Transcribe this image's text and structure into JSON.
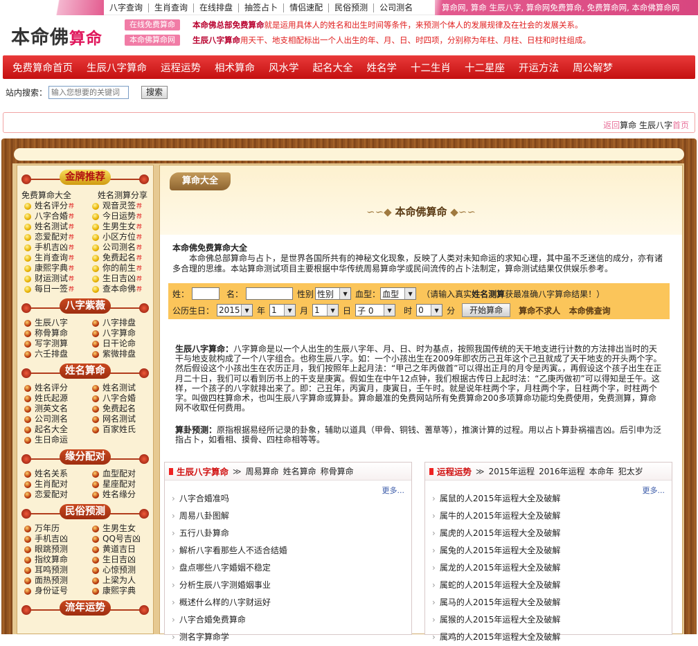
{
  "top_nav": [
    "八字查询",
    "生肖查询",
    "在线排盘",
    "抽签占卜",
    "情侣速配",
    "民俗预测",
    "公司测名"
  ],
  "top_right": "算命网, 算命  生辰八字, 算命网免费算命, 免费算命网, 本命佛算命网",
  "logo": {
    "main": "本命佛",
    "red": "算命"
  },
  "tags": [
    "在线免费算命",
    "本命佛算命网"
  ],
  "intro": [
    {
      "bold": "本命佛总部免费算命",
      "text": "就是运用具体人的姓名和出生时间等条件，来预测个体人的发展规律及在社会的发展关系。"
    },
    {
      "bold": "生辰八字算命",
      "text": "用天干、地支相配标出一个人出生的年、月、日、时四项，分别称为年柱、月柱、日柱和时柱组成。"
    }
  ],
  "main_nav": [
    "免费算命首页",
    "生辰八字算命",
    "运程运势",
    "相术算命",
    "风水学",
    "起名大全",
    "姓名学",
    "十二生肖",
    "十二星座",
    "开运方法",
    "周公解梦"
  ],
  "search": {
    "label": "站内搜索：",
    "placeholder": "输入您想要的关键词",
    "button": "搜索"
  },
  "breadcrumb": {
    "back": "返回",
    "path": "算命 生辰八字",
    "home": "首页"
  },
  "sidebar": {
    "sections": [
      {
        "title": "金牌推荐",
        "style": "gold",
        "subhdr": [
          "免费算命大全",
          "姓名测算分享"
        ],
        "icon": "bulb",
        "hot": true,
        "items": [
          "姓名评分",
          "观音灵签",
          "八字合婚",
          "今日运势",
          "姓名测试",
          "生男生女",
          "恋爱配对",
          "小区方位",
          "手机吉凶",
          "公司测名",
          "生肖查询",
          "免费起名",
          "康熙字典",
          "你的前生",
          "财运测试",
          "生日吉凶",
          "每日一签",
          "查本命佛"
        ]
      },
      {
        "title": "八字紫薇",
        "icon": "coin",
        "items": [
          "生辰八字",
          "八字排盘",
          "称骨算命",
          "八字算命",
          "写字测算",
          "日干论命",
          "六壬排盘",
          "紫微排盘"
        ]
      },
      {
        "title": "姓名算命",
        "icon": "coin",
        "items": [
          "姓名评分",
          "姓名测试",
          "姓氏起源",
          "八字合婚",
          "测英文名",
          "免费起名",
          "公司测名",
          "网名测试",
          "起名大全",
          "百家姓氏",
          "生日命运"
        ]
      },
      {
        "title": "缘分配对",
        "icon": "coin",
        "items": [
          "姓名关系",
          "血型配对",
          "生肖配对",
          "星座配对",
          "恋爱配对",
          "姓名缘分"
        ]
      },
      {
        "title": "民俗预测",
        "icon": "coin",
        "items": [
          "万年历",
          "生男生女",
          "手机吉凶",
          "QQ号吉凶",
          "眼跳预测",
          "黄道吉日",
          "指纹算命",
          "生日吉凶",
          "耳鸣预测",
          "心惊预测",
          "面热预测",
          "上梁为人",
          "身份证号",
          "康熙字典"
        ]
      },
      {
        "title": "流年运势",
        "icon": "coin",
        "items": []
      }
    ]
  },
  "content": {
    "tab": "算命大全",
    "title": "本命佛算命",
    "desc_title": "本命佛免费算命大全",
    "desc_text": "本命佛总部算命与占卜，是世界各国所共有的神秘文化现象，反映了人类对未知命运的求知心理，其中虽不乏迷信的成分，亦有诸多合理的思维。本站算命测试项目主要根据中华传统周易算命学或民间流传的占卜法制定，算命测试结果仅供娱乐参考。",
    "form": {
      "surname": "姓：",
      "name": "名：",
      "gender_label": "性别",
      "gender": "性别",
      "blood_label": "血型：",
      "blood": "血型",
      "hint_pre": "（请输入真实",
      "hint_bold": "姓名测算",
      "hint_post": "获最准确八字算命结果！）",
      "birth_label": "公历生日：",
      "year": "2015",
      "year_u": "年",
      "month": "1",
      "month_u": "月",
      "day": "1",
      "day_u": "日",
      "hour": "子 0",
      "hour_u": "时",
      "minute": "0",
      "minute_u": "分",
      "submit": "开始算命",
      "slogan": "算命不求人   本命佛查询"
    },
    "para1_title": "生辰八字算命：",
    "para1": "八字算命是以一个人出生的生辰八字年、月、日、时为基点，按照我国传统的天干地支进行计数的方法排出当时的天干与地支就构成了一个八字组合。也称生辰八字。如：一个小孩出生在2009年即农历己丑年这个己丑就成了天干地支的开头两个字。然后假设这个小孩出生在农历正月，我们按照年上起月法：“甲己之年丙做首”可以得出正月的月令是丙寅。，再假设这个孩子出生在正月二十日，我们可以看到历书上的干支是庚寅。假如生在中午12点钟，我们根据古传日上起时法：“乙庚丙做初”可以得知是壬午。这样，一个孩子的八字就排出来了。即：己丑年，丙寅月，庚寅日，壬午时。就是说年柱两个字，月柱两个字，日柱两个字，时柱两个字。叫做四柱算命术，也叫生辰八字算命或算卦。算命最准的免费网站所有免费算命200多项算命功能均免费使用，免费测算，算命网不收取任何费用。",
    "para2_title": "算卦预测：",
    "para2": "原指根据易经所记录的卦象，辅助以道具（甲骨、铜钱、蓍草等），推演计算的过程。用以占卜算卦祸福吉凶。后引申为泛指占卜，如看相、摸骨、四柱命相等等。",
    "box_left": {
      "main": "生辰八字算命",
      "subs": [
        "周易算命",
        "姓名算命",
        "称骨算命"
      ],
      "more": "更多...",
      "items": [
        "八字合婚准吗",
        "周易八卦图解",
        "五行八卦算命",
        "解析八字看那些人不适合结婚",
        "盘点哪些八字婚姻不稳定",
        "分析生辰八字测婚姻事业",
        "概述什么样的八字财运好",
        "八字合婚免费算命",
        "测名字算命学"
      ]
    },
    "box_right": {
      "main": "运程运势",
      "subs": [
        "2015年运程",
        "2016年运程",
        "本命年",
        "犯太岁"
      ],
      "more": "更多...",
      "items": [
        "属鼠的人2015年运程大全及破解",
        "属牛的人2015年运程大全及破解",
        "属虎的人2015年运程大全及破解",
        "属兔的人2015年运程大全及破解",
        "属龙的人2015年运程大全及破解",
        "属蛇的人2015年运程大全及破解",
        "属马的人2015年运程大全及破解",
        "属猴的人2015年运程大全及破解",
        "属鸡的人2015年运程大全及破解"
      ]
    }
  }
}
